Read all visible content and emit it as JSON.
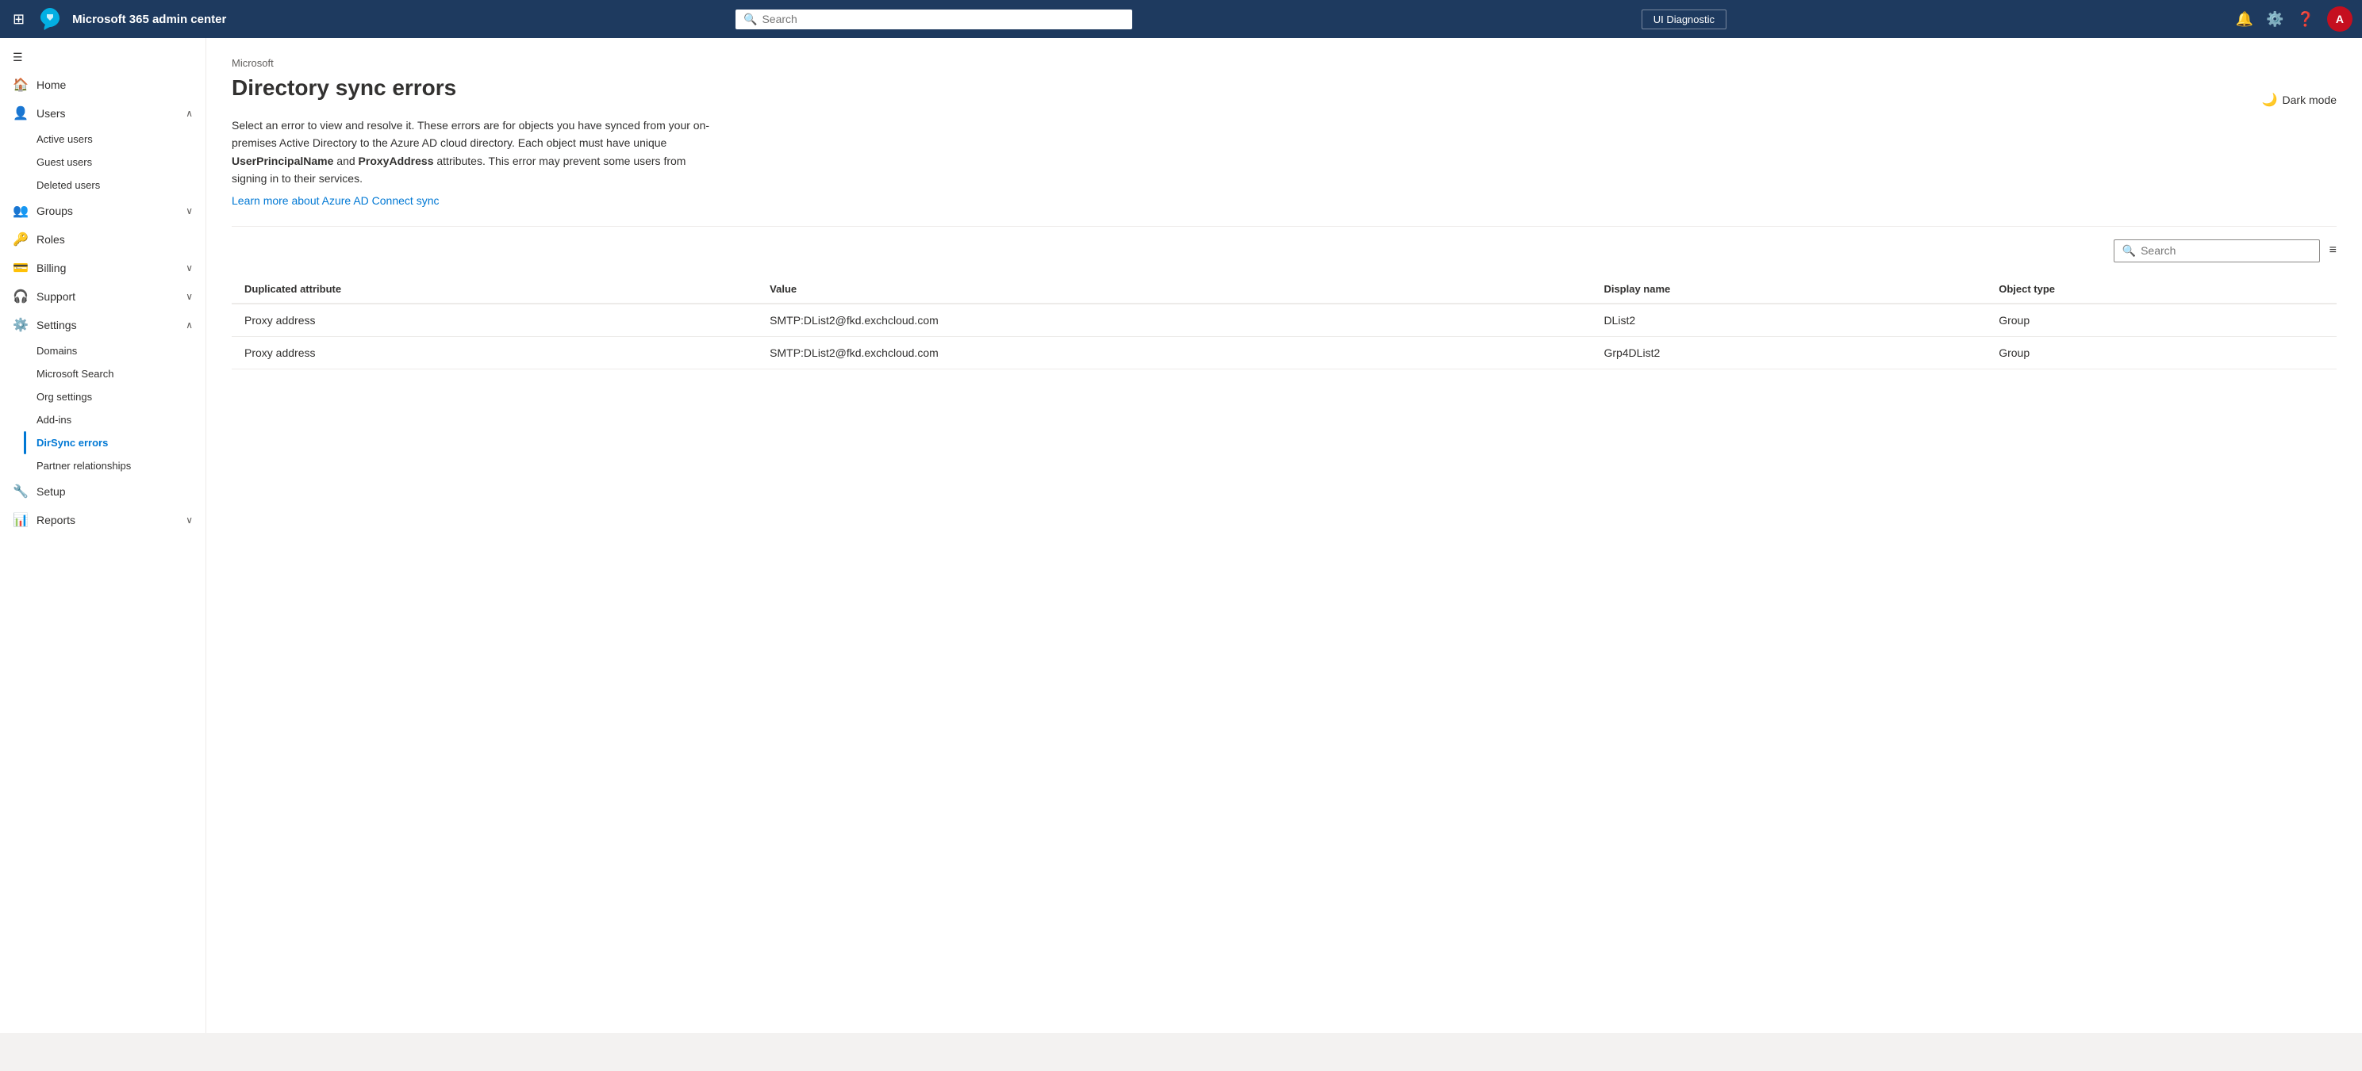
{
  "topNav": {
    "title": "Microsoft 365 admin center",
    "searchPlaceholder": "Search",
    "uiDiagnosticLabel": "UI Diagnostic",
    "avatarInitial": "A"
  },
  "darkMode": {
    "label": "Dark mode"
  },
  "sidebar": {
    "collapseLabel": "Collapse",
    "items": [
      {
        "id": "home",
        "label": "Home",
        "icon": "🏠",
        "hasChildren": false
      },
      {
        "id": "users",
        "label": "Users",
        "icon": "👤",
        "hasChildren": true,
        "expanded": true,
        "children": [
          {
            "id": "active-users",
            "label": "Active users"
          },
          {
            "id": "guest-users",
            "label": "Guest users"
          },
          {
            "id": "deleted-users",
            "label": "Deleted users"
          }
        ]
      },
      {
        "id": "groups",
        "label": "Groups",
        "icon": "👥",
        "hasChildren": true,
        "expanded": false
      },
      {
        "id": "roles",
        "label": "Roles",
        "icon": "🔑",
        "hasChildren": false
      },
      {
        "id": "billing",
        "label": "Billing",
        "icon": "💳",
        "hasChildren": true,
        "expanded": false
      },
      {
        "id": "support",
        "label": "Support",
        "icon": "🎧",
        "hasChildren": true,
        "expanded": false
      },
      {
        "id": "settings",
        "label": "Settings",
        "icon": "⚙️",
        "hasChildren": true,
        "expanded": true,
        "children": [
          {
            "id": "domains",
            "label": "Domains"
          },
          {
            "id": "microsoft-search",
            "label": "Microsoft Search"
          },
          {
            "id": "org-settings",
            "label": "Org settings"
          },
          {
            "id": "add-ins",
            "label": "Add-ins"
          },
          {
            "id": "dirsync-errors",
            "label": "DirSync errors",
            "active": true
          },
          {
            "id": "partner-relationships",
            "label": "Partner relationships"
          }
        ]
      },
      {
        "id": "setup",
        "label": "Setup",
        "icon": "🔧",
        "hasChildren": false
      },
      {
        "id": "reports",
        "label": "Reports",
        "icon": "📊",
        "hasChildren": true,
        "expanded": false
      }
    ]
  },
  "page": {
    "breadcrumb": "Microsoft",
    "title": "Directory sync errors",
    "description": "Select an error to view and resolve it. These errors are for objects you have synced from your on-premises Active Directory to the Azure AD cloud directory. Each object must have unique ",
    "boldText1": "UserPrincipalName",
    "middleText": " and ",
    "boldText2": "ProxyAddress",
    "endText": " attributes. This error may prevent some users from signing in to their services.",
    "learnMoreText": "Learn more about Azure AD Connect sync",
    "learnMoreHref": "#",
    "tableSearchPlaceholder": "Search",
    "table": {
      "columns": [
        {
          "id": "duplicated-attribute",
          "label": "Duplicated attribute"
        },
        {
          "id": "value",
          "label": "Value"
        },
        {
          "id": "display-name",
          "label": "Display name"
        },
        {
          "id": "object-type",
          "label": "Object type"
        }
      ],
      "rows": [
        {
          "duplicatedAttribute": "Proxy address",
          "value": "SMTP:DList2@fkd.exchcloud.com",
          "displayName": "DList2",
          "objectType": "Group"
        },
        {
          "duplicatedAttribute": "Proxy address",
          "value": "SMTP:DList2@fkd.exchcloud.com",
          "displayName": "Grp4DList2",
          "objectType": "Group"
        }
      ]
    }
  }
}
